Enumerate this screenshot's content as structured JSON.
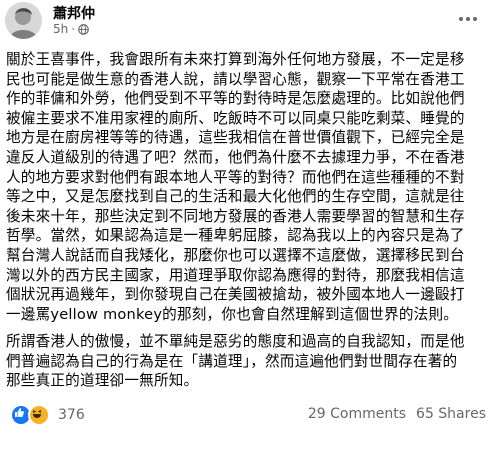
{
  "post": {
    "author": "蕭邦仲",
    "timestamp": "5h",
    "separator": "·",
    "audience_icon": "globe-icon",
    "more_icon": "more-options-icon"
  },
  "content": {
    "paragraph1": [
      "關於王喜事件，我會跟所有未來打算到海外任何地方發展，不一定是移",
      "民也可能是做生意的香港人說，請以學習心態，觀察一下平常在香港工",
      "作的菲傭和外勞，他們受到不平等的對待時是怎麼處理的。比如說他們",
      "被僱主要求不准用家裡的廁所、吃飯時不可以同桌只能吃剩菜、睡覺的",
      "地方是在廚房裡等等的待遇，這些我相信在普世價值觀下，已經完全是",
      "違反人道級別的待遇了吧？然而，他們為什麼不去據理力爭，不在香港",
      "人的地方要求對他們有跟本地人平等的對待？而他們在這些種種的不對",
      "等之中，又是怎麼找到自己的生活和最大化他們的生存空間，這就是往",
      "後未來十年，那些決定到不同地方發展的香港人需要學習的智慧和生存",
      "哲學。當然，如果認為這是一種卑躬屈膝，認為我以上的內容只是為了",
      "幫台灣人說話而自我矮化，那麼你也可以選擇不這麼做，選擇移民到台",
      "灣以外的西方民主國家，用道理爭取你認為應得的對待，那麼我相信這",
      "個狀況再過幾年，到你發現自己在美國被搶劫，被外國本地人一邊毆打",
      "一邊罵yellow monkey的那刻，你也會自然理解到這個世界的法則。"
    ],
    "paragraph2": [
      "所謂香港人的傲慢，並不單純是惡劣的態度和過高的自我認知，而是他",
      "們普遍認為自己的行為是在「講道理」，然而這遍他們對世間存在著的",
      "那些真正的道理卻一無所知。"
    ]
  },
  "footer": {
    "reaction_icons": [
      "like-icon",
      "haha-icon"
    ],
    "reaction_count": "376",
    "comments": "29 Comments",
    "shares": "65 Shares"
  },
  "colors": {
    "text": "#050505",
    "secondary": "#65676b",
    "like_blue": "#1877f2",
    "haha_yellow": "#f7b125"
  }
}
